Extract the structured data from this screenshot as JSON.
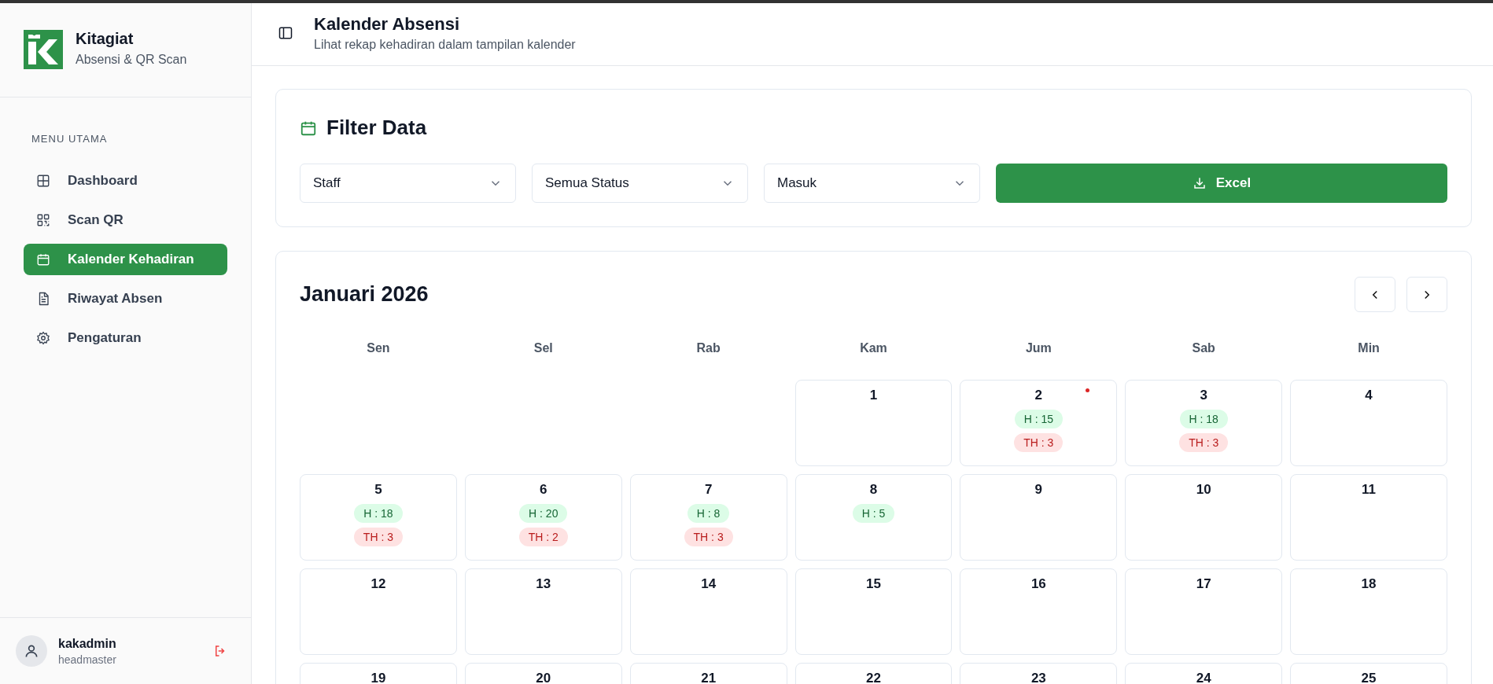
{
  "brand": {
    "name": "Kitagiat",
    "tagline": "Absensi & QR Scan"
  },
  "sidebar": {
    "section": "MENU UTAMA",
    "items": [
      {
        "label": "Dashboard",
        "kind": "grid",
        "selected": false
      },
      {
        "label": "Scan QR",
        "kind": "qr",
        "selected": false
      },
      {
        "label": "Kalender Kehadiran",
        "kind": "calendar",
        "selected": true
      },
      {
        "label": "Riwayat Absen",
        "kind": "document",
        "selected": false
      },
      {
        "label": "Pengaturan",
        "kind": "gear",
        "selected": false
      }
    ]
  },
  "user": {
    "name": "kakadmin",
    "role": "headmaster"
  },
  "header": {
    "title": "Kalender Absensi",
    "subtitle": "Lihat rekap kehadiran dalam tampilan kalender"
  },
  "filter": {
    "title": "Filter Data",
    "selects": [
      {
        "value": "Staff"
      },
      {
        "value": "Semua Status"
      },
      {
        "value": "Masuk"
      }
    ],
    "export_button": "Excel"
  },
  "calendar": {
    "month": "Januari 2026",
    "weekdays": [
      "Sen",
      "Sel",
      "Rab",
      "Kam",
      "Jum",
      "Sab",
      "Min"
    ],
    "cells": [
      {
        "kind": "empty"
      },
      {
        "kind": "empty"
      },
      {
        "kind": "empty"
      },
      {
        "kind": "day",
        "day": "1",
        "today": false
      },
      {
        "kind": "day",
        "day": "2",
        "today": true,
        "present": "H : 15",
        "absent": "TH : 3"
      },
      {
        "kind": "day",
        "day": "3",
        "today": false,
        "present": "H : 18",
        "absent": "TH : 3"
      },
      {
        "kind": "day",
        "day": "4",
        "today": false
      },
      {
        "kind": "day",
        "day": "5",
        "today": false,
        "present": "H : 18",
        "absent": "TH : 3"
      },
      {
        "kind": "day",
        "day": "6",
        "today": false,
        "present": "H : 20",
        "absent": "TH : 2"
      },
      {
        "kind": "day",
        "day": "7",
        "today": false,
        "present": "H : 8",
        "absent": "TH : 3"
      },
      {
        "kind": "day",
        "day": "8",
        "today": false,
        "present": "H : 5"
      },
      {
        "kind": "day",
        "day": "9",
        "today": false
      },
      {
        "kind": "day",
        "day": "10",
        "today": false
      },
      {
        "kind": "day",
        "day": "11",
        "today": false
      },
      {
        "kind": "day",
        "day": "12",
        "today": false
      },
      {
        "kind": "day",
        "day": "13",
        "today": false
      },
      {
        "kind": "day",
        "day": "14",
        "today": false
      },
      {
        "kind": "day",
        "day": "15",
        "today": false
      },
      {
        "kind": "day",
        "day": "16",
        "today": false
      },
      {
        "kind": "day",
        "day": "17",
        "today": false
      },
      {
        "kind": "day",
        "day": "18",
        "today": false
      },
      {
        "kind": "day",
        "day": "19",
        "today": false
      },
      {
        "kind": "day",
        "day": "20",
        "today": false
      },
      {
        "kind": "day",
        "day": "21",
        "today": false
      },
      {
        "kind": "day",
        "day": "22",
        "today": false
      },
      {
        "kind": "day",
        "day": "23",
        "today": false
      },
      {
        "kind": "day",
        "day": "24",
        "today": false
      },
      {
        "kind": "day",
        "day": "25",
        "today": false
      }
    ]
  }
}
